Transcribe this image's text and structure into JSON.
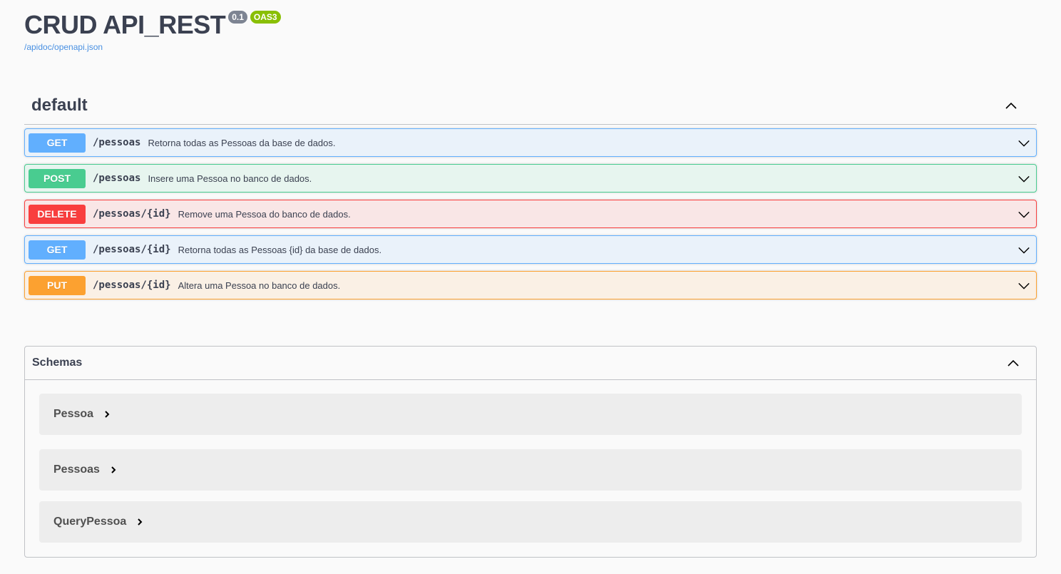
{
  "info": {
    "title": "CRUD API_REST",
    "version": "0.1",
    "oas": "OAS3",
    "spec_url": "/apidoc/openapi.json"
  },
  "tag": {
    "name": "default",
    "operations": [
      {
        "method": "GET",
        "path": "/pessoas",
        "summary": "Retorna todas as Pessoas da base de dados."
      },
      {
        "method": "POST",
        "path": "/pessoas",
        "summary": "Insere uma Pessoa no banco de dados."
      },
      {
        "method": "DELETE",
        "path": "/pessoas/{id}",
        "summary": "Remove uma Pessoa do banco de dados."
      },
      {
        "method": "GET",
        "path": "/pessoas/{id}",
        "summary": "Retorna todas as Pessoas {id} da base de dados."
      },
      {
        "method": "PUT",
        "path": "/pessoas/{id}",
        "summary": "Altera uma Pessoa no banco de dados."
      }
    ]
  },
  "schemas": {
    "title": "Schemas",
    "models": [
      "Pessoa",
      "Pessoas",
      "QueryPessoa"
    ]
  },
  "colors": {
    "get": "#61affe",
    "post": "#49cc90",
    "delete": "#f93e3e",
    "put": "#fca130",
    "version_badge": "#7d8492",
    "oas_badge": "#89bf04",
    "link": "#4990e2"
  },
  "icons": {
    "collapse": "chevron-up-icon",
    "expand": "chevron-down-icon",
    "model_expand": "chevron-right-icon"
  }
}
